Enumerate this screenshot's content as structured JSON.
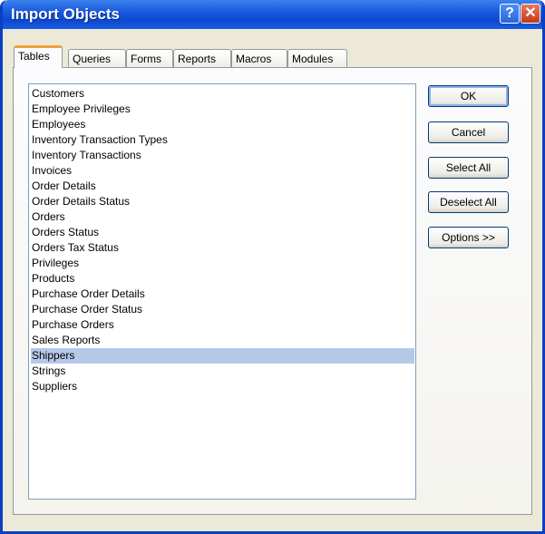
{
  "window": {
    "title": "Import Objects",
    "help_label": "?",
    "close_label": "✕"
  },
  "tabs": [
    {
      "label": "Tables",
      "active": true
    },
    {
      "label": "Queries",
      "active": false
    },
    {
      "label": "Forms",
      "active": false
    },
    {
      "label": "Reports",
      "active": false
    },
    {
      "label": "Macros",
      "active": false
    },
    {
      "label": "Modules",
      "active": false
    }
  ],
  "tables": {
    "items": [
      "Customers",
      "Employee Privileges",
      "Employees",
      "Inventory Transaction Types",
      "Inventory Transactions",
      "Invoices",
      "Order Details",
      "Order Details Status",
      "Orders",
      "Orders Status",
      "Orders Tax Status",
      "Privileges",
      "Products",
      "Purchase Order Details",
      "Purchase Order Status",
      "Purchase Orders",
      "Sales Reports",
      "Shippers",
      "Strings",
      "Suppliers"
    ],
    "selected": "Shippers"
  },
  "buttons": {
    "ok": "OK",
    "cancel": "Cancel",
    "select_all": "Select All",
    "deselect_all": "Deselect All",
    "options": "Options >>"
  },
  "colors": {
    "titlebar": "#0b48d0",
    "dialog_bg": "#ece9d8",
    "selection": "#b6c8e8",
    "active_tab_accent": "#f3a13a"
  }
}
